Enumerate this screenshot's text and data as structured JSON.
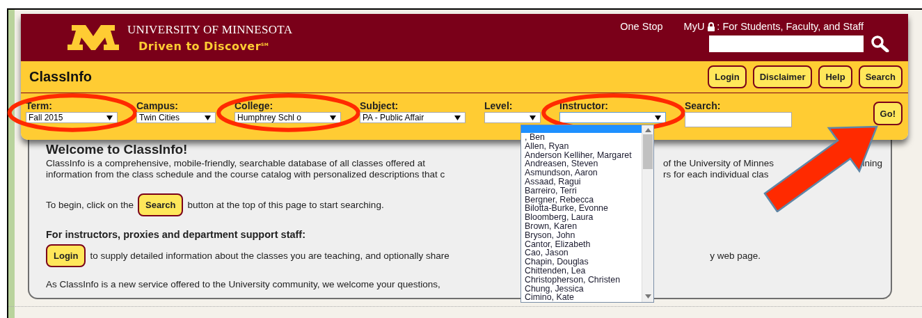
{
  "header": {
    "logo_title": "UNIVERSITY OF MINNESOTA",
    "logo_tagline": "Driven to Discover$^{SM}$",
    "links": [
      {
        "kind": "plain",
        "label": "One Stop"
      },
      {
        "kind": "locked",
        "label": "MyU",
        "suffix": ": For Students, Faculty, and Staff"
      }
    ]
  },
  "app_bar": {
    "title": "ClassInfo",
    "buttons": [
      "Login",
      "Disclaimer",
      "Help",
      "Search"
    ]
  },
  "filters": [
    {
      "kind": "select",
      "label": "Term:",
      "value": "Fall 2015",
      "focused": false,
      "circled": true
    },
    {
      "kind": "select",
      "label": "Campus:",
      "value": "Twin Cities",
      "focused": false,
      "circled": false
    },
    {
      "kind": "select",
      "label": "College:",
      "value": "Humphrey Schl o",
      "focused": false,
      "circled": true
    },
    {
      "kind": "select",
      "label": "Subject:",
      "value": "PA - Public Affair",
      "focused": false,
      "circled": false
    },
    {
      "kind": "select",
      "label": "Level:",
      "focused": false,
      "circled": false
    },
    {
      "kind": "select",
      "label": "Instructor:",
      "focused": true,
      "circled": true
    },
    {
      "kind": "text",
      "label": "Search:",
      "focused": false,
      "circled": false
    }
  ],
  "go_button": {
    "label": "Go!",
    "arrow_annotation": true
  },
  "welcome": {
    "heading": "Welcome to ClassInfo!",
    "intro_lines": [
      {
        "left": "ClassInfo is a comprehensive, mobile-friendly, searchable database of all classes offered at",
        "right": [
          "of the University of Minnes",
          "ining"
        ]
      },
      {
        "left": "information from the class schedule and the course catalog with personalized descriptions that c",
        "right": [
          "rs for each individual clas"
        ]
      }
    ],
    "begin": {
      "before": "To begin, click on the",
      "button": "Search",
      "after": "button at the top of this page to start searching."
    },
    "staff_heading": "For instructors, proxies and department support staff:",
    "login_line": {
      "button": "Login",
      "text": "to supply detailed information about the classes you are teaching, and optionally share",
      "right": "y web page."
    },
    "closing": "As ClassInfo is a new service offered to the University community, we welcome your questions,"
  },
  "instructor_dropdown": {
    "options": [
      ", Ben",
      "Allen, Ryan",
      "Anderson Kelliher, Margaret",
      "Andreasen, Steven",
      "Asmundson, Aaron",
      "Assaad, Ragui",
      "Barreiro, Terri",
      "Bergner, Rebecca",
      "Bilotta-Burke, Evonne",
      "Bloomberg, Laura",
      "Brown, Karen",
      "Bryson, John",
      "Cantor, Elizabeth",
      "Cao, Jason",
      "Chapin, Douglas",
      "Chittenden, Lea",
      "Christopherson, Christen",
      "Chung, Jessica",
      "Cimino, Kate"
    ]
  }
}
